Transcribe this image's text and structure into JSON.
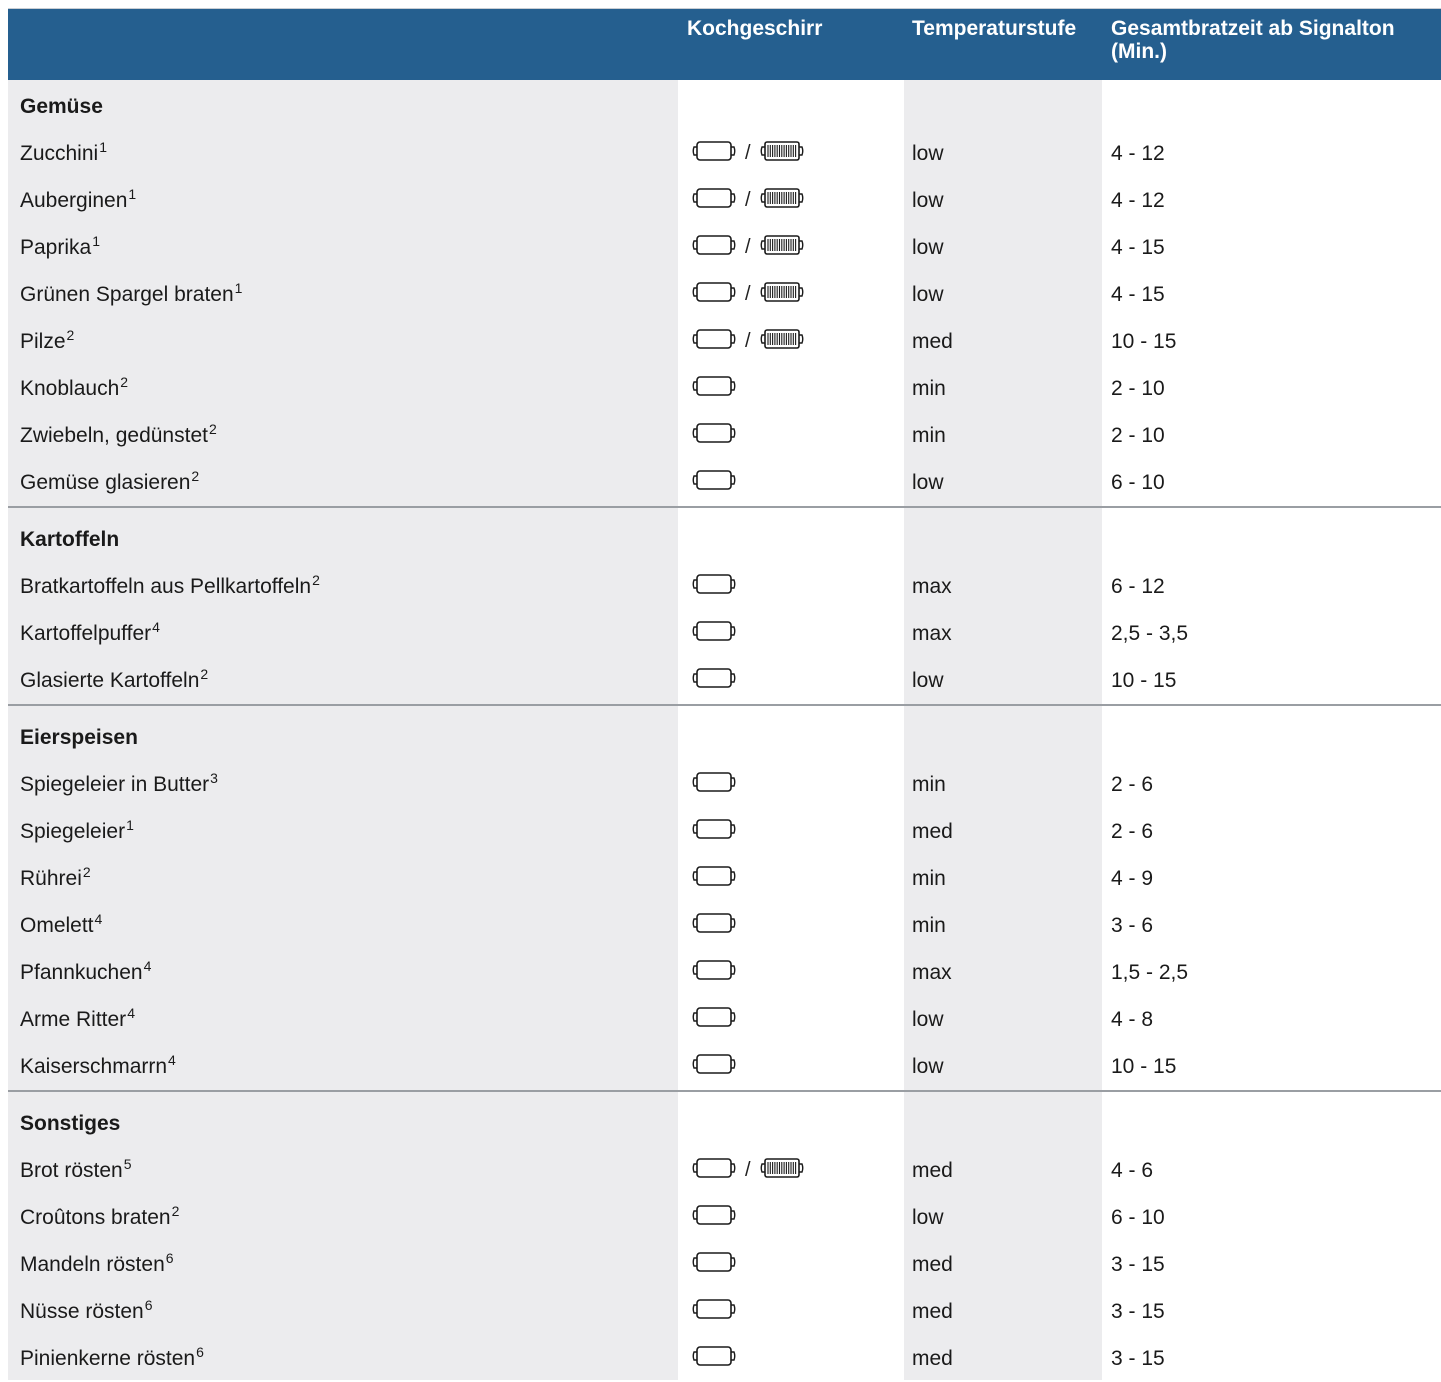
{
  "header": {
    "col_cookware": "Kochgeschirr",
    "col_temp": "Temperaturstufe",
    "col_time_line1": "Gesamtbratzeit ab Signalton",
    "col_time_line2": "(Min.)"
  },
  "separator": "/",
  "sections": [
    {
      "title": "Gemüse",
      "items": [
        {
          "name": "Zucchini",
          "note": "1",
          "pans": [
            "pan-icon",
            "grill-pan-icon"
          ],
          "temp": "low",
          "time": "4 - 12"
        },
        {
          "name": "Auberginen",
          "note": "1",
          "pans": [
            "pan-icon",
            "grill-pan-icon"
          ],
          "temp": "low",
          "time": "4 - 12"
        },
        {
          "name": "Paprika",
          "note": "1",
          "pans": [
            "pan-icon",
            "grill-pan-icon"
          ],
          "temp": "low",
          "time": "4 - 15"
        },
        {
          "name": "Grünen Spargel braten",
          "note": "1",
          "pans": [
            "pan-icon",
            "grill-pan-icon"
          ],
          "temp": "low",
          "time": "4 - 15"
        },
        {
          "name": "Pilze",
          "note": "2",
          "pans": [
            "pan-icon",
            "grill-pan-icon"
          ],
          "temp": "med",
          "time": "10 - 15"
        },
        {
          "name": "Knoblauch",
          "note": "2",
          "pans": [
            "pan-icon"
          ],
          "temp": "min",
          "time": "2 - 10"
        },
        {
          "name": "Zwiebeln, gedünstet",
          "note": "2",
          "pans": [
            "pan-icon"
          ],
          "temp": "min",
          "time": "2 - 10"
        },
        {
          "name": "Gemüse glasieren",
          "note": "2",
          "pans": [
            "pan-icon"
          ],
          "temp": "low",
          "time": "6 - 10"
        }
      ]
    },
    {
      "title": "Kartoffeln",
      "items": [
        {
          "name": "Bratkartoffeln aus Pellkartoffeln",
          "note": "2",
          "pans": [
            "pan-icon"
          ],
          "temp": "max",
          "time": "6 - 12"
        },
        {
          "name": "Kartoffelpuffer",
          "note": "4",
          "pans": [
            "pan-icon"
          ],
          "temp": "max",
          "time": "2,5 - 3,5"
        },
        {
          "name": "Glasierte Kartoffeln",
          "note": "2",
          "pans": [
            "pan-icon"
          ],
          "temp": "low",
          "time": "10 - 15"
        }
      ]
    },
    {
      "title": "Eierspeisen",
      "items": [
        {
          "name": "Spiegeleier in Butter",
          "note": "3",
          "pans": [
            "pan-icon"
          ],
          "temp": "min",
          "time": "2 - 6"
        },
        {
          "name": "Spiegeleier",
          "note": "1",
          "pans": [
            "pan-icon"
          ],
          "temp": "med",
          "time": "2 - 6"
        },
        {
          "name": "Rührei",
          "note": "2",
          "pans": [
            "pan-icon"
          ],
          "temp": "min",
          "time": "4 - 9"
        },
        {
          "name": "Omelett",
          "note": "4",
          "pans": [
            "pan-icon"
          ],
          "temp": "min",
          "time": "3 - 6"
        },
        {
          "name": "Pfannkuchen",
          "note": "4",
          "pans": [
            "pan-icon"
          ],
          "temp": "max",
          "time": "1,5 - 2,5"
        },
        {
          "name": "Arme Ritter",
          "note": "4",
          "pans": [
            "pan-icon"
          ],
          "temp": "low",
          "time": "4 - 8"
        },
        {
          "name": "Kaiserschmarrn",
          "note": "4",
          "pans": [
            "pan-icon"
          ],
          "temp": "low",
          "time": "10 - 15"
        }
      ]
    },
    {
      "title": "Sonstiges",
      "items": [
        {
          "name": "Brot rösten",
          "note": "5",
          "pans": [
            "pan-icon",
            "grill-pan-icon"
          ],
          "temp": "med",
          "time": "4 - 6"
        },
        {
          "name": "Croûtons braten",
          "note": "2",
          "pans": [
            "pan-icon"
          ],
          "temp": "low",
          "time": "6 - 10"
        },
        {
          "name": "Mandeln rösten",
          "note": "6",
          "pans": [
            "pan-icon"
          ],
          "temp": "med",
          "time": "3 - 15"
        },
        {
          "name": "Nüsse rösten",
          "note": "6",
          "pans": [
            "pan-icon"
          ],
          "temp": "med",
          "time": "3 - 15"
        },
        {
          "name": "Pinienkerne rösten",
          "note": "6",
          "pans": [
            "pan-icon"
          ],
          "temp": "med",
          "time": "3 - 15"
        }
      ]
    }
  ],
  "colors": {
    "header_bg": "#255f8f",
    "header_text": "#ffffff",
    "band": "#ececee",
    "divider": "#9a9ea3"
  }
}
